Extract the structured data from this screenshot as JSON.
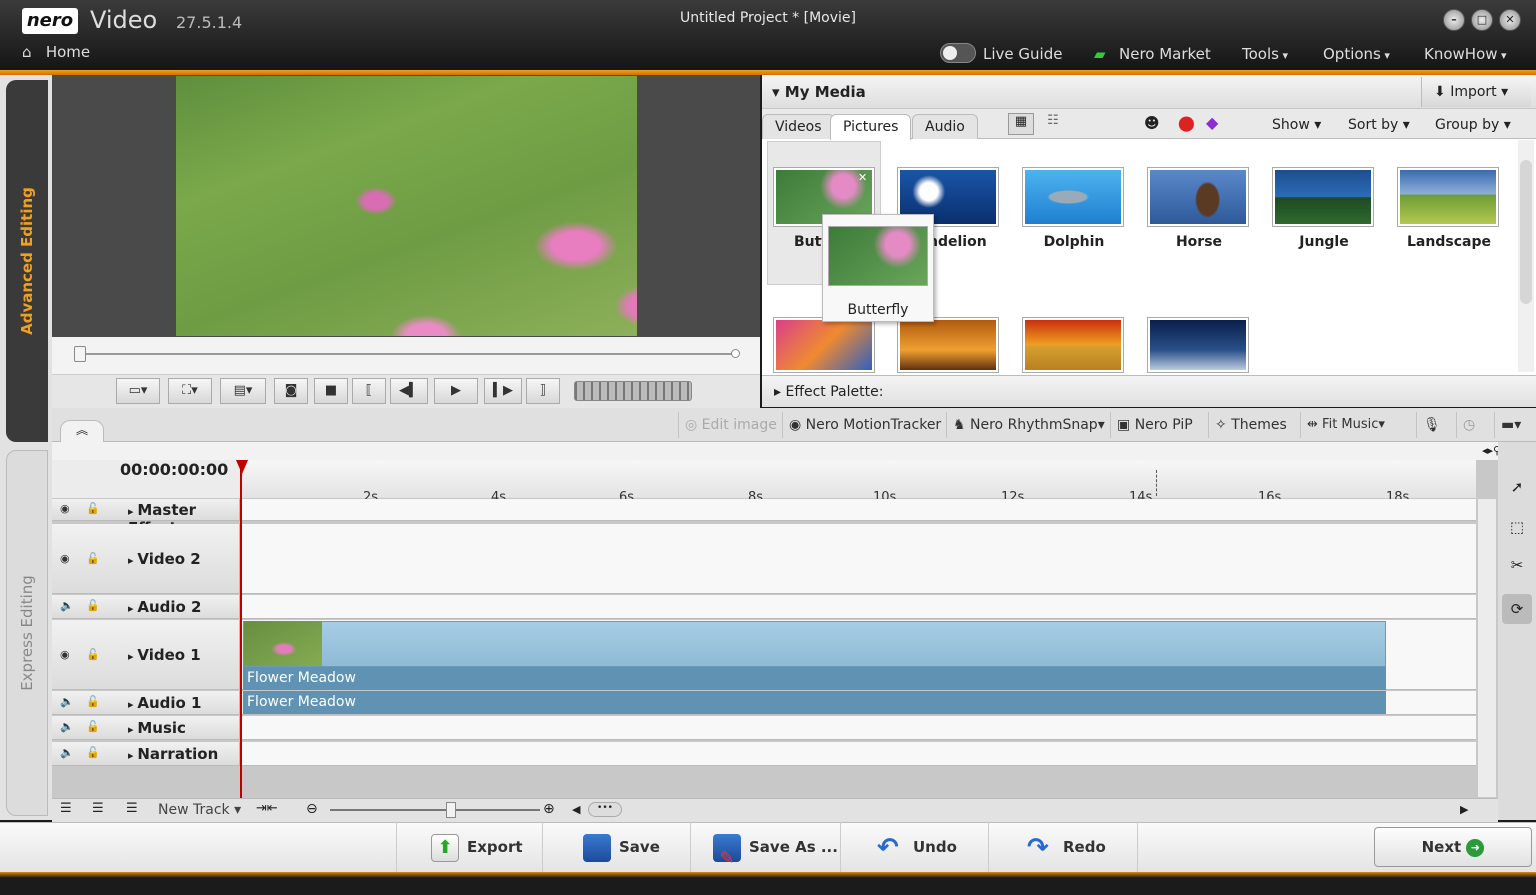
{
  "titlebar": {
    "logo": "nero",
    "app": "Video",
    "version": "27.5.1.4",
    "project": "Untitled Project * [Movie]",
    "home": "Home"
  },
  "menu": {
    "live_guide": "Live Guide",
    "market": "Nero Market",
    "tools": "Tools",
    "options": "Options",
    "knowhow": "KnowHow"
  },
  "lefttabs": {
    "advanced": "Advanced Editing",
    "express": "Express Editing"
  },
  "media": {
    "title": "My Media",
    "import": "Import",
    "tabs": [
      "Videos",
      "Pictures",
      "Audio"
    ],
    "show": "Show",
    "sortby": "Sort by",
    "groupby": "Group by",
    "items": [
      {
        "label": "Butt"
      },
      {
        "label": "ndelion"
      },
      {
        "label": "Dolphin"
      },
      {
        "label": "Horse"
      },
      {
        "label": "Jungle"
      },
      {
        "label": "Landscape"
      }
    ],
    "tooltip": "Butterfly"
  },
  "effect_palette": "Effect Palette:",
  "tools": {
    "edit_image": "Edit image",
    "motion": "Nero MotionTracker",
    "rhythm": "Nero RhythmSnap",
    "pip": "Nero PiP",
    "themes": "Themes",
    "fit_music": "Fit Music"
  },
  "timeline": {
    "timecode": "00:00:00:00",
    "ticks": [
      "2s",
      "4s",
      "6s",
      "8s",
      "10s",
      "12s",
      "14s",
      "16s",
      "18s"
    ],
    "tracks": [
      "Master Effects",
      "Video 2",
      "Audio 2",
      "Video 1",
      "Audio 1",
      "Music",
      "Narration"
    ],
    "clip_video": "Flower Meadow",
    "clip_audio": "Flower Meadow",
    "new_track": "New Track"
  },
  "bottom": {
    "export": "Export",
    "save": "Save",
    "save_as": "Save As ...",
    "undo": "Undo",
    "redo": "Redo",
    "next": "Next"
  },
  "colors": {
    "accent": "#e68a00",
    "clip": "#5f92b3",
    "playhead": "#c00000"
  }
}
